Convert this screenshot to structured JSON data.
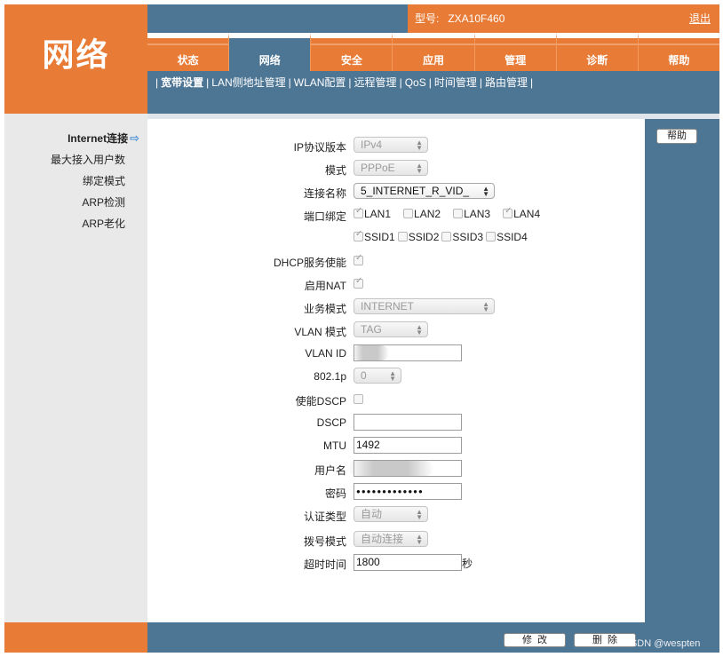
{
  "header": {
    "logo_text": "网络",
    "model_label": "型号:",
    "model_value": "ZXA10F460",
    "logout_label": "退出"
  },
  "tabs": [
    {
      "label": "状态",
      "active": false
    },
    {
      "label": "网络",
      "active": true
    },
    {
      "label": "安全",
      "active": false
    },
    {
      "label": "应用",
      "active": false
    },
    {
      "label": "管理",
      "active": false
    },
    {
      "label": "诊断",
      "active": false
    },
    {
      "label": "帮助",
      "active": false
    }
  ],
  "subnav": {
    "lead": "|",
    "items": [
      "宽带设置",
      "LAN侧地址管理",
      "WLAN配置",
      "远程管理",
      "QoS",
      "时间管理",
      "路由管理"
    ],
    "trail": "|"
  },
  "sidebar": {
    "items": [
      "Internet连接",
      "最大接入用户数",
      "绑定模式",
      "ARP检测",
      "ARP老化"
    ],
    "current_arrow": "⇨"
  },
  "help_button": "帮助",
  "form": {
    "ip_version": {
      "label": "IP协议版本",
      "value": "IPv4"
    },
    "mode": {
      "label": "模式",
      "value": "PPPoE"
    },
    "conn_name": {
      "label": "连接名称",
      "value": "5_INTERNET_R_VID_"
    },
    "port_binding": {
      "label": "端口绑定",
      "lan": [
        {
          "name": "LAN1",
          "checked": true
        },
        {
          "name": "LAN2",
          "checked": false
        },
        {
          "name": "LAN3",
          "checked": false
        },
        {
          "name": "LAN4",
          "checked": true
        }
      ],
      "ssid": [
        {
          "name": "SSID1",
          "checked": true
        },
        {
          "name": "SSID2",
          "checked": false
        },
        {
          "name": "SSID3",
          "checked": false
        },
        {
          "name": "SSID4",
          "checked": false
        }
      ]
    },
    "dhcp": {
      "label": "DHCP服务使能",
      "checked": true
    },
    "nat": {
      "label": "启用NAT",
      "checked": true
    },
    "service_mode": {
      "label": "业务模式",
      "value": "INTERNET"
    },
    "vlan_mode": {
      "label": "VLAN 模式",
      "value": "TAG"
    },
    "vlan_id": {
      "label": "VLAN ID",
      "value": ""
    },
    "dot1p": {
      "label": "802.1p",
      "value": "0"
    },
    "dscp_enable": {
      "label": "使能DSCP",
      "checked": false
    },
    "dscp": {
      "label": "DSCP",
      "value": ""
    },
    "mtu": {
      "label": "MTU",
      "value": "1492"
    },
    "username": {
      "label": "用户名",
      "value": ""
    },
    "password": {
      "label": "密码",
      "value": "●●●●●●●●●●●●●"
    },
    "auth_type": {
      "label": "认证类型",
      "value": "自动"
    },
    "dial_mode": {
      "label": "拨号模式",
      "value": "自动连接"
    },
    "timeout": {
      "label": "超时时间",
      "value": "1800",
      "unit": "秒"
    }
  },
  "footer": {
    "modify_label": "修改",
    "delete_label": "删除",
    "watermark": "CSDN @wespten"
  },
  "colors": {
    "orange": "#e87b35",
    "steel_blue": "#4d7594",
    "sidebar_gray": "#e9e9e9"
  }
}
